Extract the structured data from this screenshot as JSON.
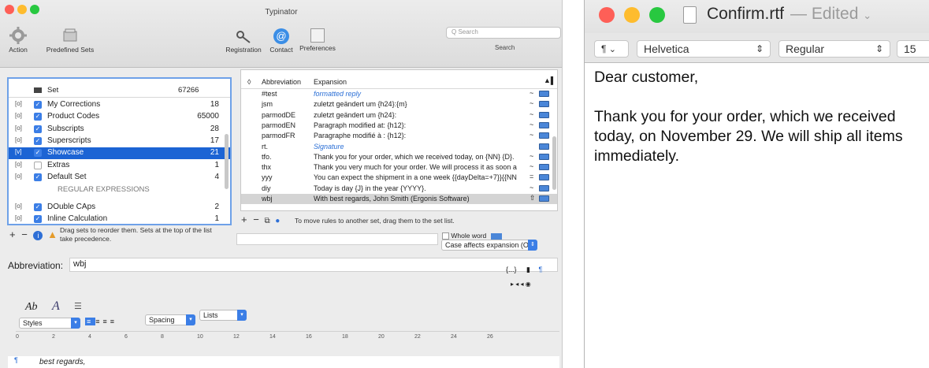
{
  "typinator": {
    "window_title": "Typinator",
    "toolbar": {
      "action_label": "Action",
      "predefined_label": "Predefined Sets",
      "registration_label": "Registration",
      "contact_label": "Contact",
      "preferences_label": "Preferences",
      "search_placeholder": "Q Search",
      "search_label": "Search"
    },
    "sets": {
      "header": {
        "name": "Set",
        "count": "67266"
      },
      "items": [
        {
          "bracket": "[o]",
          "checked": true,
          "name": "My Corrections",
          "count": "18"
        },
        {
          "bracket": "[o]",
          "checked": true,
          "name": "Product Codes",
          "count": "65000"
        },
        {
          "bracket": "[o]",
          "checked": true,
          "name": "Subscripts",
          "count": "28"
        },
        {
          "bracket": "[o]",
          "checked": true,
          "name": "Superscripts",
          "count": "17"
        },
        {
          "bracket": "[v]",
          "checked": true,
          "name": "Showcase",
          "count": "21",
          "selected": true
        },
        {
          "bracket": "[o]",
          "checked": false,
          "name": "Extras",
          "count": "1"
        },
        {
          "bracket": "[o]",
          "checked": true,
          "name": "Default Set",
          "count": "4"
        }
      ],
      "section_label": "REGULAR EXPRESSIONS",
      "regex_items": [
        {
          "bracket": "[o]",
          "checked": true,
          "name": "DOuble CAps",
          "count": "2"
        },
        {
          "bracket": "[o]",
          "checked": true,
          "name": "Inline Calculation",
          "count": "1"
        }
      ],
      "hint": "Drag sets to reorder them. Sets at the top of the list take precedence."
    },
    "abbreviations": {
      "header": {
        "sort": "◊",
        "abbreviation": "Abbreviation",
        "expansion": "Expansion"
      },
      "rows": [
        {
          "abbr": "#test",
          "expansion": "formatted reply",
          "styled": true,
          "flag": "~"
        },
        {
          "abbr": "jsm",
          "expansion": "zuletzt geändert um {h24}:{m}",
          "styled": false,
          "flag": "~"
        },
        {
          "abbr": "parmodDE",
          "expansion": "zuletzt geändert um {h24}:",
          "styled": false,
          "flag": "~"
        },
        {
          "abbr": "parmodEN",
          "expansion": "Paragraph modified at: {h12}:",
          "styled": false,
          "flag": "~"
        },
        {
          "abbr": "parmodFR",
          "expansion": "Paragraphe modifié à : {h12}:",
          "styled": false,
          "flag": "~"
        },
        {
          "abbr": "rt.",
          "expansion": "Signature",
          "styled": true,
          "flag": ""
        },
        {
          "abbr": "tfo.",
          "expansion": "Thank you for your order, which we received today, on {NN} {D}.",
          "styled": false,
          "flag": "~"
        },
        {
          "abbr": "thx",
          "expansion": "Thank you very much for your order. We will process it as soon a",
          "styled": false,
          "flag": "~"
        },
        {
          "abbr": "yyy",
          "expansion": "You can expect the shipment in a one week {{dayDelta=+7}}{{NN",
          "styled": false,
          "flag": "="
        },
        {
          "abbr": "diy",
          "expansion": "Today is day {J} in the year {YYYY}.",
          "styled": false,
          "flag": "~"
        },
        {
          "abbr": "wbj",
          "expansion": "With best regards,  John  Smith  (Ergonis Software)",
          "styled": false,
          "flag": "⇧",
          "selected": true
        }
      ],
      "hint": "To move rules to another set, drag them to the set list."
    },
    "options": {
      "whole_word": "Whole word",
      "case_label": "Case affects expansion (O)"
    },
    "abbreviation_field": {
      "label": "Abbreviation:",
      "value": "wbj"
    },
    "editor": {
      "styles_label": "Styles",
      "spacing_label": "Spacing",
      "lists_label": "Lists",
      "ruler": [
        "0",
        "2",
        "4",
        "6",
        "8",
        "10",
        "12",
        "14",
        "16",
        "18",
        "20",
        "22",
        "24",
        "26"
      ],
      "body_text": "best regards,",
      "top_right": "{...}",
      "brace_marker": "¶"
    }
  },
  "textedit": {
    "file_name": "Confirm.rtf",
    "edited_label": "— Edited",
    "paragraph_label": "¶",
    "font_family": "Helvetica",
    "font_style": "Regular",
    "font_size": "15",
    "body": [
      "Dear customer,",
      "",
      "Thank you for your order, which we received today, on November 29. We will ship all items immediately."
    ],
    "colors": {
      "close": "#fe5f57",
      "minimize": "#febc2e",
      "zoom": "#28c840"
    }
  }
}
